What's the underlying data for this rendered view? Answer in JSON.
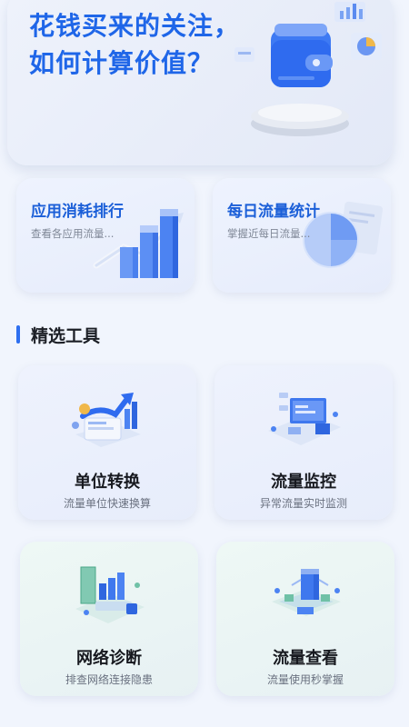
{
  "hero": {
    "title_line1": "花钱买来的关注，",
    "title_line2": "如何计算价值？"
  },
  "top_cards": [
    {
      "title": "应用消耗排行",
      "subtitle": "查看各应用流量..."
    },
    {
      "title": "每日流量统计",
      "subtitle": "掌握近每日流量..."
    }
  ],
  "section": {
    "title": "精选工具"
  },
  "tools": [
    {
      "title": "单位转换",
      "subtitle": "流量单位快速换算"
    },
    {
      "title": "流量监控",
      "subtitle": "异常流量实时监测"
    },
    {
      "title": "网络诊断",
      "subtitle": "排查网络连接隐患"
    },
    {
      "title": "流量查看",
      "subtitle": "流量使用秒掌握"
    }
  ],
  "colors": {
    "accent": "#1f66e8",
    "page_bg": "#f1f5fd"
  }
}
